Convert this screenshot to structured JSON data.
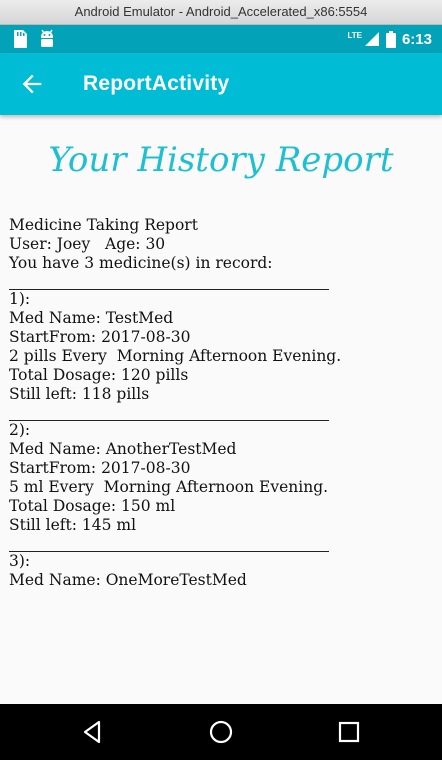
{
  "window": {
    "title": "Android Emulator - Android_Accelerated_x86:5554"
  },
  "status_bar": {
    "network": "LTE",
    "time": "6:13"
  },
  "app_bar": {
    "title": "ReportActivity"
  },
  "heading": "Your History Report",
  "report": {
    "header": [
      "Medicine Taking Report",
      "User: Joey   Age: 30",
      "You have 3 medicine(s) in record:"
    ],
    "entries": [
      {
        "index": "1):",
        "name": "Med Name: TestMed",
        "start": "StartFrom: 2017-08-30",
        "schedule": "2 pills Every  Morning Afternoon Evening.",
        "total": "Total Dosage: 120 pills",
        "left": "Still left: 118 pills"
      },
      {
        "index": "2):",
        "name": "Med Name: AnotherTestMed",
        "start": "StartFrom: 2017-08-30",
        "schedule": "5 ml Every  Morning Afternoon Evening.",
        "total": "Total Dosage: 150 ml",
        "left": "Still left: 145 ml"
      },
      {
        "index": "3):",
        "name": "Med Name: OneMoreTestMed"
      }
    ]
  },
  "colors": {
    "status_bar": "#02a3b8",
    "app_bar": "#00bcd4",
    "heading": "#1ebfcf"
  }
}
